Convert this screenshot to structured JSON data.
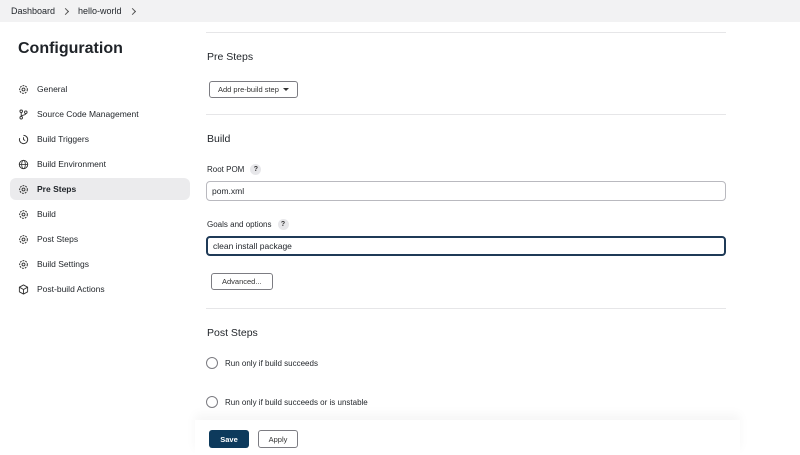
{
  "breadcrumb": {
    "items": [
      "Dashboard",
      "hello-world"
    ]
  },
  "sidebar": {
    "title": "Configuration",
    "items": [
      {
        "label": "General",
        "icon": "gear-icon"
      },
      {
        "label": "Source Code Management",
        "icon": "branch-icon"
      },
      {
        "label": "Build Triggers",
        "icon": "clock-icon"
      },
      {
        "label": "Build Environment",
        "icon": "globe-icon"
      },
      {
        "label": "Pre Steps",
        "icon": "gear-icon",
        "active": true
      },
      {
        "label": "Build",
        "icon": "gear-icon"
      },
      {
        "label": "Post Steps",
        "icon": "gear-icon"
      },
      {
        "label": "Build Settings",
        "icon": "gear-icon"
      },
      {
        "label": "Post-build Actions",
        "icon": "cube-icon"
      }
    ]
  },
  "pre_steps": {
    "title": "Pre Steps",
    "add_button": "Add pre-build step"
  },
  "build": {
    "title": "Build",
    "root_pom_label": "Root POM",
    "root_pom_value": "pom.xml",
    "goals_label": "Goals and options",
    "goals_value": "clean install package",
    "advanced_button": "Advanced..."
  },
  "post_steps": {
    "title": "Post Steps",
    "options": [
      "Run only if build succeeds",
      "Run only if build succeeds or is unstable"
    ]
  },
  "footer": {
    "save_label": "Save",
    "apply_label": "Apply"
  },
  "help_glyph": "?",
  "colors": {
    "primary": "#0d3a5c",
    "active_bg": "#ebebed",
    "breadcrumb_bg": "#f2f2f3"
  }
}
